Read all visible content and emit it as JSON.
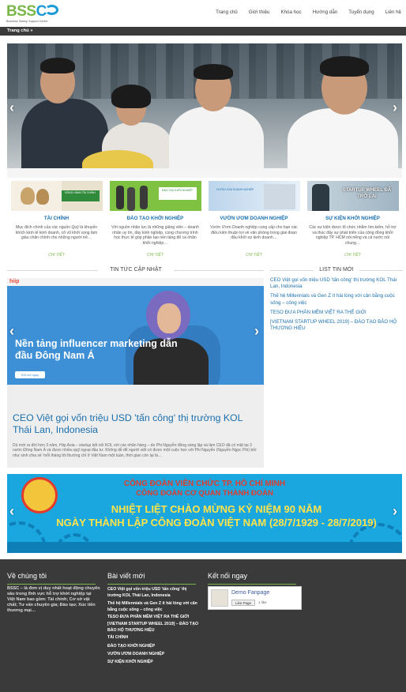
{
  "header": {
    "logo_main": "BSSC",
    "logo_sub": "Business Startup Support Centre",
    "nav": [
      "Trang chủ",
      "Giới thiệu",
      "Khóa học",
      "Hướng dẫn",
      "Tuyển dụng",
      "Liên hệ"
    ]
  },
  "breadcrumb": "Trang chủ »",
  "hero": {
    "prev": "‹",
    "next": "›"
  },
  "categories": [
    {
      "title": "TÀI CHÍNH",
      "desc": "Mục đích chính của các nguồn Quỹ là khuyến khích kinh tế kinh doanh, cổ vũ khởi vọng làm giàu chân chính cho những người trẻ…",
      "more": "CHI TIẾT",
      "image_text": "ĐỒNG HÀNH TÀI CHÍNH"
    },
    {
      "title": "ĐÀO TẠO KHỞI NGHIỆP",
      "desc": "Với nguồn nhân lực là những giảng viên – doanh nhân uy tín, dày kinh nghiệp, cùng chương trình học thực tế góp phần tạo nền tảng để cá nhân khởi nghiệp…",
      "more": "CHI TIẾT",
      "image_text": "ĐÀO TẠO KHỞI NGHIỆP"
    },
    {
      "title": "VƯỜN ƯƠM DOANH NGHIỆP",
      "desc": "Vườn Ươm Doanh nghiệp cung cấp cho bạn các điều kiện thuận lợi về văn phòng trong giai đoạn đầu khởi sự kinh doanh…",
      "more": "CHI TIẾT",
      "image_text": "VƯỜN ƯƠM DOANH NGHIỆP"
    },
    {
      "title": "SỰ KIỆN KHỞI NGHIỆP",
      "desc": "Các sự kiện được tổ chức nhằm tìm kiếm, hỗ trợ và thúc đẩy sự phát triển của cộng đồng khởi nghiệp TP. HCM nói riêng và cả nước nói chung…",
      "more": "CHI TIẾT",
      "image_text": "STARTUP WHEEL ĐÃ TRỞ LẠI"
    }
  ],
  "news_section": {
    "title": "TIN TỨC CẬP NHẬT",
    "slide_logo": "hiip",
    "slide_headline": "Nền tảng influencer marketing dẫn đầu Đông Nam Á",
    "slide_button": "Kết nối ngay",
    "article_title": "CEO Việt gọi vốn triệu USD 'tấn công' thị trường KOL Thái Lan, Indonesia",
    "article_excerpt": "Dù mới ra đời hơn 3 năm, Hiip Asia – startup kết nối KOL với các nhãn hàng – do Phi Nguyễn đồng sáng lập và làm CEO đã có mặt tại 3 nước Đông Nam Á và được nhiều quỹ ngoại đầu tư. Không dễ để người việt có được một cuộc hẹn với Phi Nguyễn (Nguyễn Ngọc Phi) bởi như sinh chia sẻ 'mỗi tháng tôi thường chỉ ở Việt Nam một tuần, thời gian còn lại là…"
  },
  "list_section": {
    "title": "LIST TIN MỚI",
    "items": [
      "CEO Việt gọi vốn triệu USD 'tấn công' thị trường KOL Thái Lan, Indonesia",
      "Thế hệ Millennials và Gen Z ít hài lòng với cân bằng cuộc sống – công việc",
      "TESO ĐƯA PHẦN MỀM VIỆT RA THẾ GIỚI",
      "[VIETNAM STARTUP WHEEL 2019] – ĐÀO TẠO BẢO HỘ THƯƠNG HIỆU"
    ]
  },
  "banner": {
    "line1": "CÔNG ĐOÀN VIÊN CHỨC TP. HỒ CHÍ MINH",
    "line2": "CÔNG ĐOÀN CƠ QUAN THÀNH ĐOÀN",
    "line3": "NHIỆT LIỆT CHÀO MỪNG KỶ NIỆM 90 NĂM",
    "line4": "NGÀY THÀNH LẬP CÔNG ĐOÀN VIỆT NAM (28/7/1929 - 28/7/2019)"
  },
  "footer": {
    "about_title": "Về chúng tôi",
    "about_text": "BSSC – là đơn vị duy nhất hoạt động chuyên sâu trong lĩnh vực hỗ trợ khởi nghiệp tại Việt Nam bao gồm: Tài chính; Cơ sở vật chất; Tư vấn chuyên gia; Đào tạo; Xúc tiến thương mại…",
    "posts_title": "Bài viết mới",
    "posts": [
      "CEO Việt gọi vốn triệu USD 'tấn công' thị trường KOL Thái Lan, Indonesia",
      "Thế hệ Millennials và Gen Z ít hài lòng với cân bằng cuộc sống – công việc",
      "TESO ĐƯA PHẦN MỀM VIỆT RA THẾ GIỚI",
      "[VIETNAM STARTUP WHEEL 2019] – ĐÀO TẠO BẢO HỘ THƯƠNG HIỆU",
      "TÀI CHÍNH",
      "ĐÀO TẠO KHỞI NGHIỆP",
      "VƯỜN ƯƠM DOANH NGHIỆP",
      "SỰ KIỆN KHỞI NGHIỆP"
    ],
    "connect_title": "Kết nối ngay",
    "fb_name": "Demo Fanpage",
    "fb_like": "Like Page",
    "fb_count": "1 like"
  }
}
